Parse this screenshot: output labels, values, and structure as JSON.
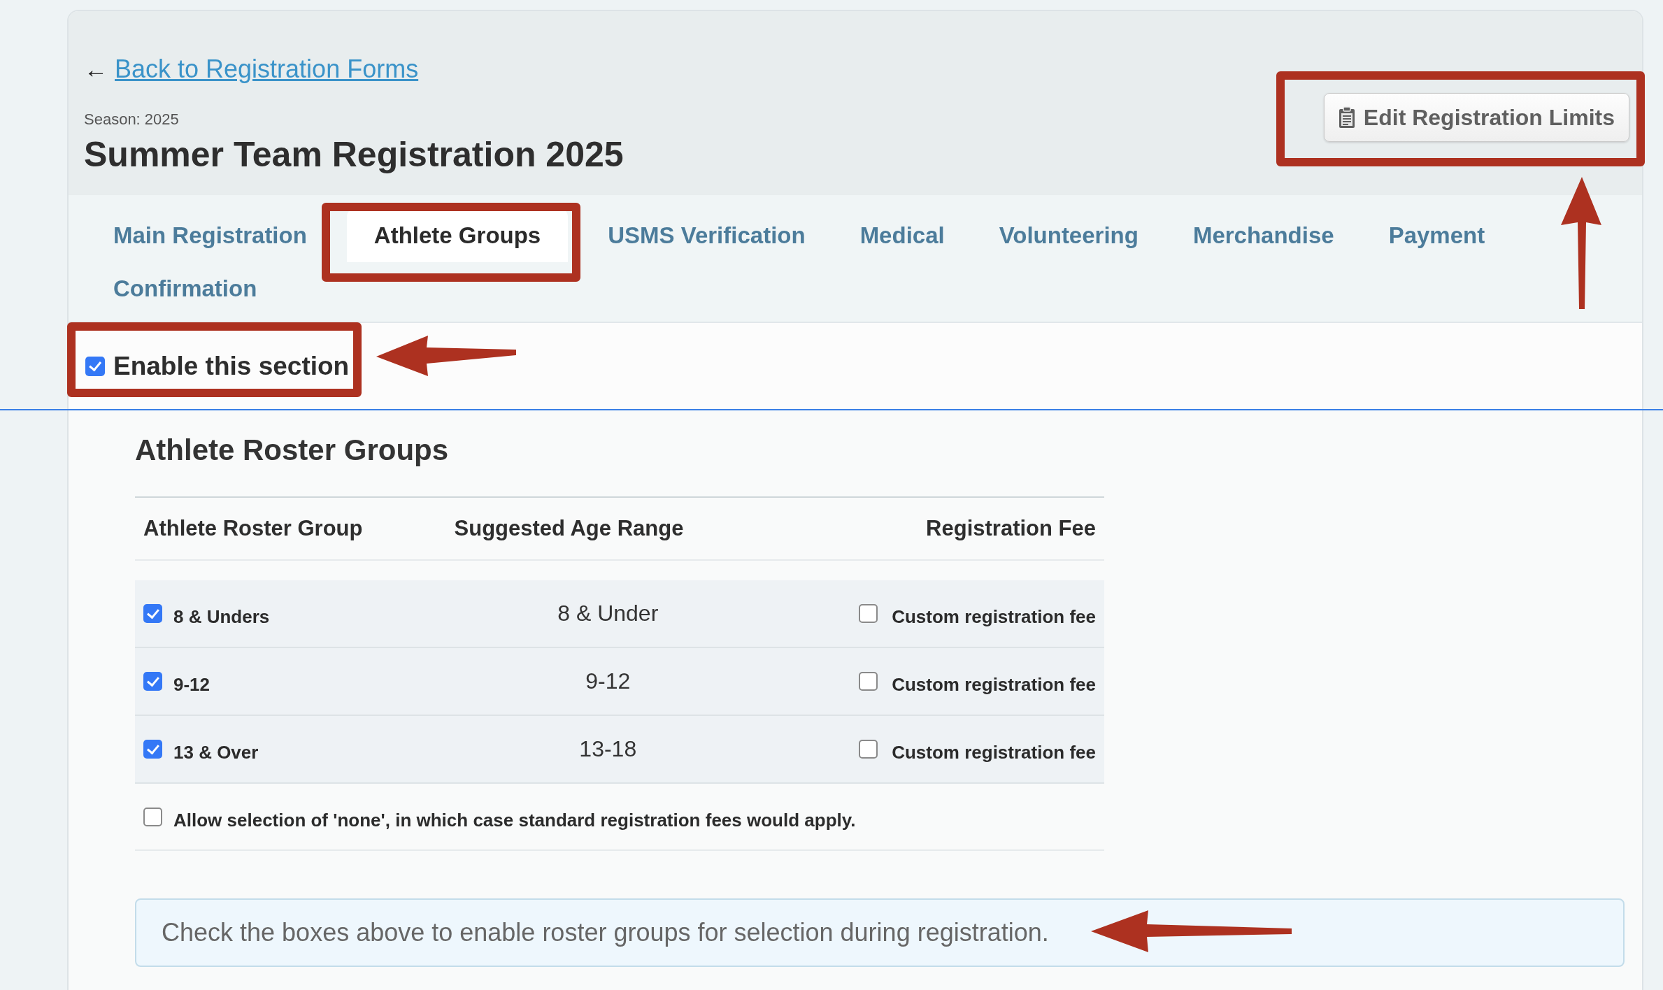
{
  "back_link": {
    "arrow": "←",
    "label": "Back to Registration Forms"
  },
  "season": "Season: 2025",
  "title": "Summer Team Registration 2025",
  "edit_button": {
    "label": "Edit Registration Limits"
  },
  "tabs": [
    {
      "label": "Main Registration",
      "selected": false
    },
    {
      "label": "Athlete Groups",
      "selected": true
    },
    {
      "label": "USMS Verification",
      "selected": false
    },
    {
      "label": "Medical",
      "selected": false
    },
    {
      "label": "Volunteering",
      "selected": false
    },
    {
      "label": "Merchandise",
      "selected": false
    },
    {
      "label": "Payment",
      "selected": false
    },
    {
      "label": "Confirmation",
      "selected": false
    }
  ],
  "enable_section": {
    "label": "Enable this section",
    "checked": true
  },
  "section_title": "Athlete Roster Groups",
  "table": {
    "columns": [
      "Athlete Roster Group",
      "Suggested Age Range",
      "Registration Fee"
    ],
    "rows": [
      {
        "group": "8 & Unders",
        "checked": true,
        "age_range": "8 & Under",
        "custom_fee_label": "Custom registration fee",
        "custom_fee_checked": false
      },
      {
        "group": "9-12",
        "checked": true,
        "age_range": "9-12",
        "custom_fee_label": "Custom registration fee",
        "custom_fee_checked": false
      },
      {
        "group": "13 & Over",
        "checked": true,
        "age_range": "13-18",
        "custom_fee_label": "Custom registration fee",
        "custom_fee_checked": false
      }
    ],
    "allow_none": {
      "label": "Allow selection of 'none', in which case standard registration fees would apply.",
      "checked": false
    }
  },
  "info": "Check the boxes above to enable roster groups for selection during registration."
}
